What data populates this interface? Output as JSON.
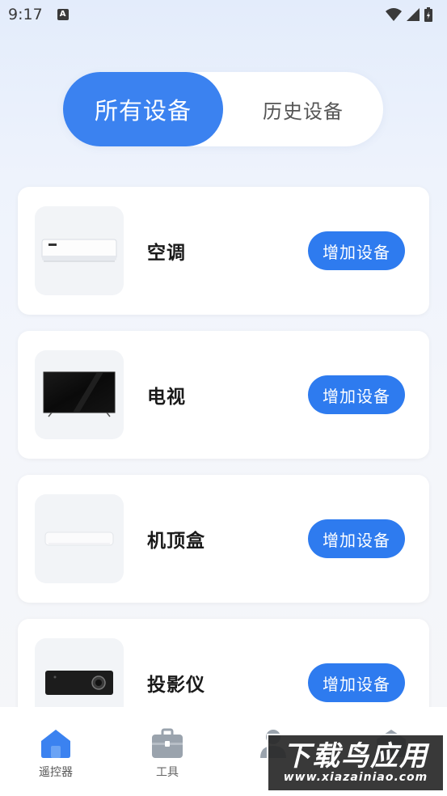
{
  "status_bar": {
    "time": "9:17",
    "notification_icon": "a-icon",
    "wifi_icon": "wifi-icon",
    "signal_icon": "signal-icon",
    "battery_icon": "battery-icon"
  },
  "tabs": {
    "all_devices": "所有设备",
    "history_devices": "历史设备",
    "active": "all_devices"
  },
  "devices": [
    {
      "name": "空调",
      "button": "增加设备",
      "icon": "air-conditioner-image"
    },
    {
      "name": "电视",
      "button": "增加设备",
      "icon": "tv-image"
    },
    {
      "name": "机顶盒",
      "button": "增加设备",
      "icon": "set-top-box-image"
    },
    {
      "name": "投影仪",
      "button": "增加设备",
      "icon": "projector-image"
    }
  ],
  "bottom_nav": {
    "items": [
      {
        "label": "遥控器",
        "icon": "home-icon",
        "active": true
      },
      {
        "label": "工具",
        "icon": "toolbox-icon",
        "active": false
      },
      {
        "label": "",
        "icon": "user-icon",
        "active": false
      },
      {
        "label": "",
        "icon": "profile-icon",
        "active": false
      }
    ]
  },
  "watermark": {
    "title": "下载鸟应用",
    "url": "www.xiazainiao.com"
  },
  "colors": {
    "accent": "#2e7bef",
    "tab_active": "#3b82f0",
    "nav_active": "#3b82f0",
    "nav_inactive": "#9aa3ad"
  }
}
